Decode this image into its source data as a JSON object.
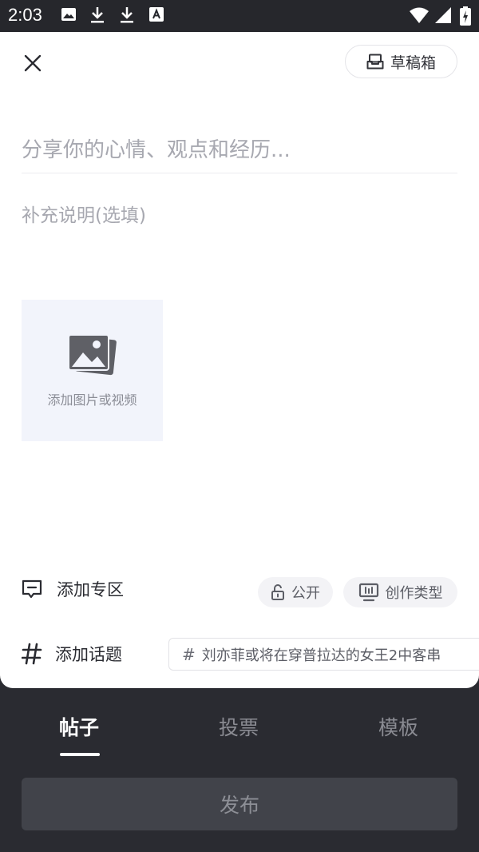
{
  "status_bar": {
    "time": "2:03",
    "icons": [
      "image-icon",
      "download-icon",
      "download-icon",
      "font-icon",
      "wifi-icon",
      "signal-icon",
      "battery-charging-icon"
    ]
  },
  "header": {
    "drafts_label": "草稿箱"
  },
  "editor": {
    "title_placeholder": "分享你的心情、观点和经历...",
    "desc_placeholder": "补充说明(选填)"
  },
  "media": {
    "add_label": "添加图片或视频"
  },
  "zone": {
    "label": "添加专区"
  },
  "chips": {
    "public_label": "公开",
    "type_label": "创作类型"
  },
  "topic": {
    "label": "添加话题",
    "suggestion": "刘亦菲或将在穿普拉达的女王2中客串"
  },
  "tabs": {
    "post": "帖子",
    "vote": "投票",
    "template": "模板",
    "active": "post"
  },
  "publish": {
    "label": "发布"
  },
  "colors": {
    "sheet_bg": "#ffffff",
    "dark_bg": "#2a2b31",
    "media_bg": "#f2f4fb",
    "placeholder": "#a7a8b0"
  }
}
